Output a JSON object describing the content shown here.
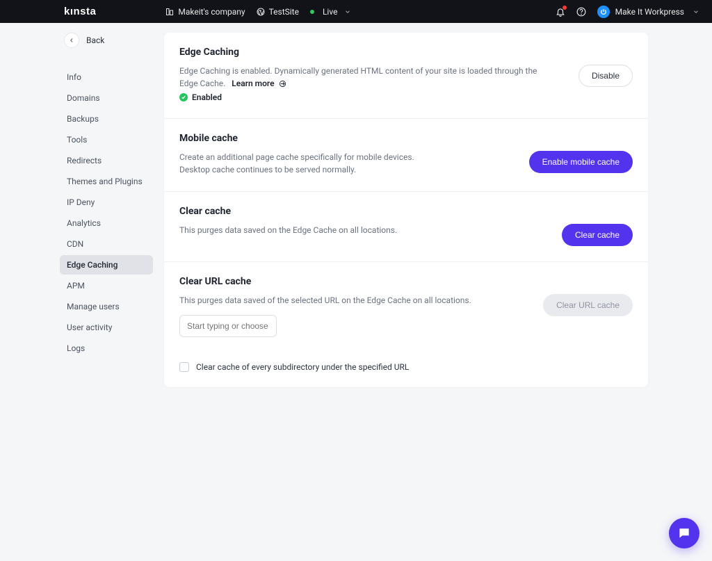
{
  "header": {
    "logo": "kınsta",
    "company": "Makeit's company",
    "site": "TestSite",
    "env": "Live",
    "user": "Make It Workpress"
  },
  "back_label": "Back",
  "sidebar": {
    "items": [
      {
        "label": "Info"
      },
      {
        "label": "Domains"
      },
      {
        "label": "Backups"
      },
      {
        "label": "Tools"
      },
      {
        "label": "Redirects"
      },
      {
        "label": "Themes and Plugins"
      },
      {
        "label": "IP Deny"
      },
      {
        "label": "Analytics"
      },
      {
        "label": "CDN"
      },
      {
        "label": "Edge Caching"
      },
      {
        "label": "APM"
      },
      {
        "label": "Manage users"
      },
      {
        "label": "User activity"
      },
      {
        "label": "Logs"
      }
    ],
    "active_index": 9
  },
  "sections": {
    "edge": {
      "title": "Edge Caching",
      "desc": "Edge Caching is enabled. Dynamically generated HTML content of your site is loaded through the Edge Cache.",
      "learn_more": "Learn more",
      "status": "Enabled",
      "button": "Disable"
    },
    "mobile": {
      "title": "Mobile cache",
      "desc1": "Create an additional page cache specifically for mobile devices.",
      "desc2": "Desktop cache continues to be served normally.",
      "button": "Enable mobile cache"
    },
    "clear": {
      "title": "Clear cache",
      "desc": "This purges data saved on the Edge Cache on all locations.",
      "button": "Clear cache"
    },
    "clear_url": {
      "title": "Clear URL cache",
      "desc": "This purges data saved of the selected URL on the Edge Cache on all locations.",
      "button": "Clear URL cache",
      "placeholder": "Start typing or choose from…",
      "checkbox": "Clear cache of every subdirectory under the specified URL"
    }
  }
}
